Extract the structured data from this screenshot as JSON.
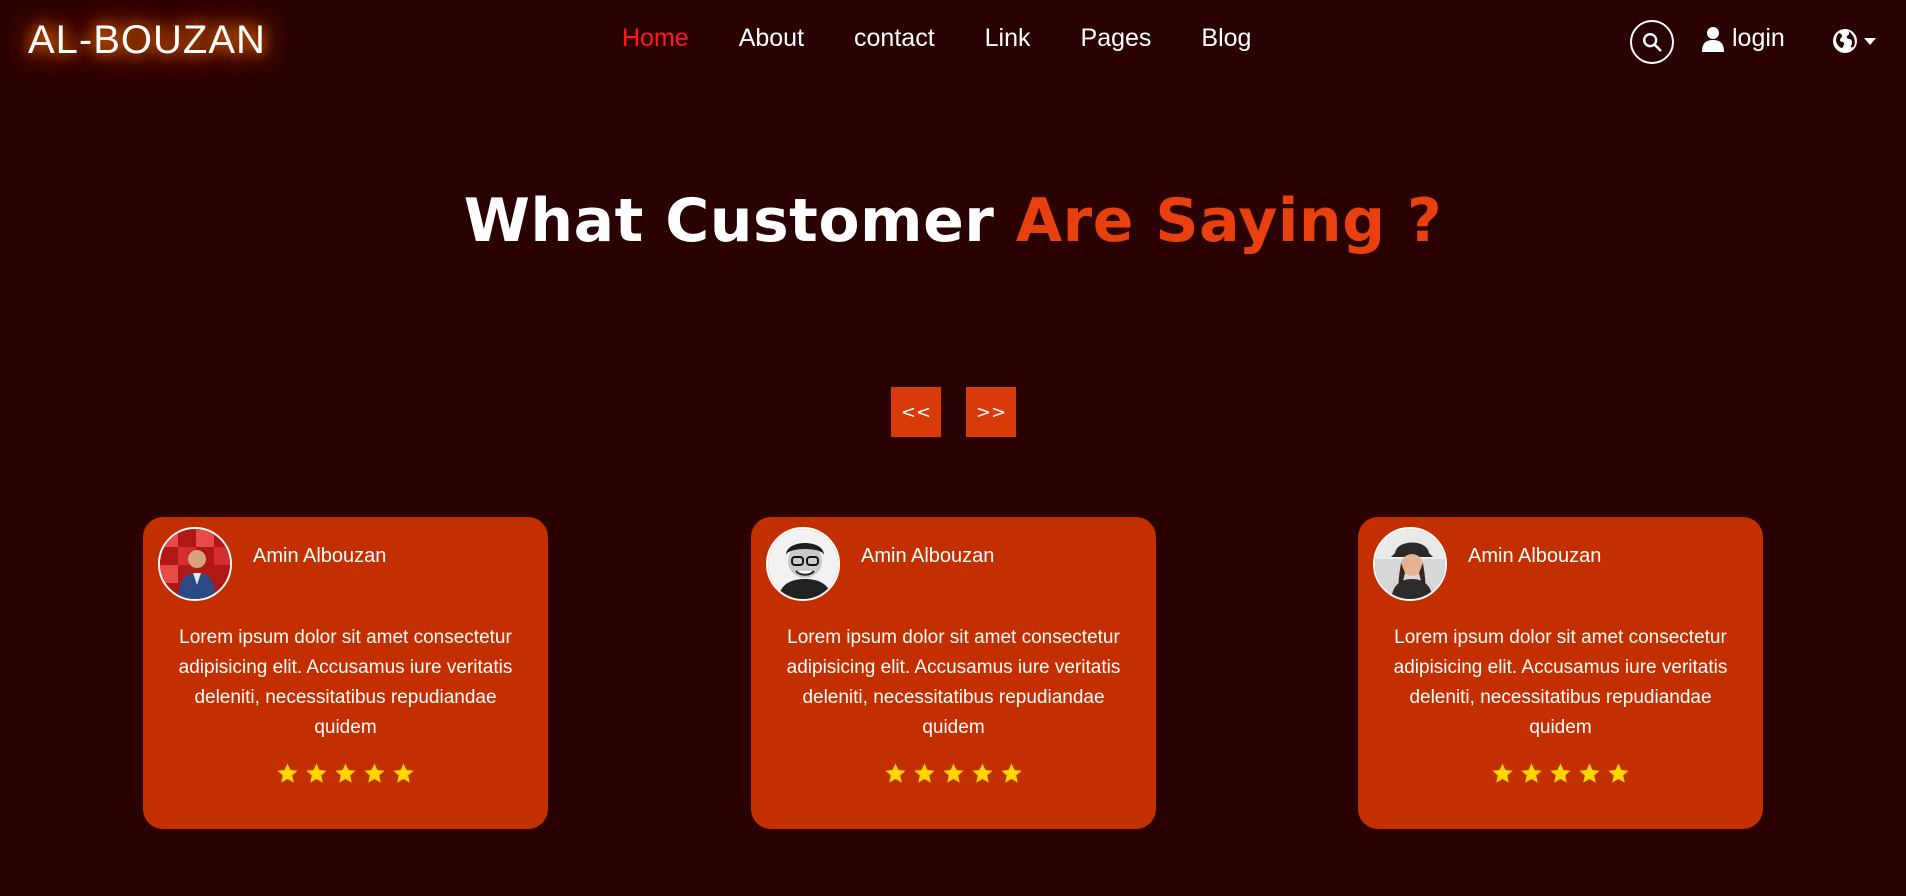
{
  "navbar": {
    "brand": "AL-BOUZAN",
    "links": [
      {
        "label": "Home",
        "active": true
      },
      {
        "label": "About"
      },
      {
        "label": "contact"
      },
      {
        "label": "Link"
      },
      {
        "label": "Pages"
      },
      {
        "label": "Blog"
      }
    ],
    "search_icon": "search-icon",
    "login_icon": "user-icon",
    "login_label": "login",
    "language_icon": "globe-icon"
  },
  "heading": {
    "part1": "What Customer ",
    "part2": "Are Saying ?"
  },
  "carousel": {
    "prev_label": "<<",
    "next_label": ">>"
  },
  "testimonials": [
    {
      "name": "Amin Albouzan",
      "text": "Lorem ipsum dolor sit amet consectetur adipisicing elit. Accusamus iure veritatis deleniti, necessitatibus repudiandae quidem",
      "rating": 5
    },
    {
      "name": "Amin Albouzan",
      "text": "Lorem ipsum dolor sit amet consectetur adipisicing elit. Accusamus iure veritatis deleniti, necessitatibus repudiandae quidem",
      "rating": 5
    },
    {
      "name": "Amin Albouzan",
      "text": "Lorem ipsum dolor sit amet consectetur adipisicing elit. Accusamus iure veritatis deleniti, necessitatibus repudiandae quidem",
      "rating": 5
    }
  ],
  "colors": {
    "background": "#2a0204",
    "accent": "#e8400f",
    "card": "#c42f00",
    "active_link": "#ff1a1a",
    "star": "#ffd600"
  }
}
